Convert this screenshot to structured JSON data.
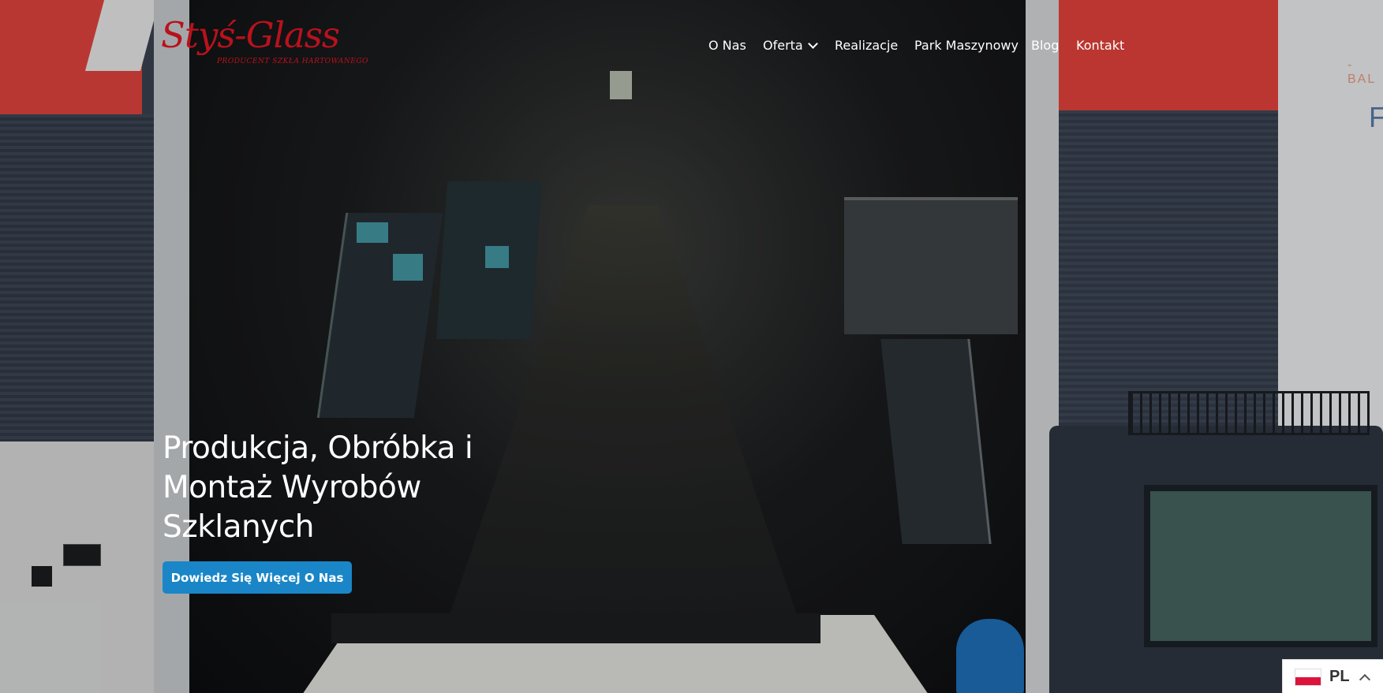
{
  "logo": {
    "main": "Styś-Glass",
    "tagline": "PRODUCENT SZKŁA HARTOWANEGO"
  },
  "nav": {
    "items": [
      {
        "label": "O Nas"
      },
      {
        "label": "Oferta",
        "has_dropdown": true
      },
      {
        "label": "Realizacje"
      },
      {
        "label": "Park Maszynowy"
      },
      {
        "label": "Blog"
      },
      {
        "label": "Kontakt"
      }
    ]
  },
  "hero": {
    "title_lines": [
      "Produkcja, Obróbka i",
      "Montaż Wyrobów",
      "Szklanych"
    ],
    "cta_label": "Dowiedz Się Więcej O Nas"
  },
  "background_signs": {
    "right_text_1": "- BAL",
    "right_text_2": "F"
  },
  "language": {
    "code": "PL",
    "flag": "poland-flag-icon"
  },
  "colors": {
    "brand_red": "#b8121c",
    "cta_blue": "#1a86c7",
    "nav_text": "#ffffff"
  }
}
